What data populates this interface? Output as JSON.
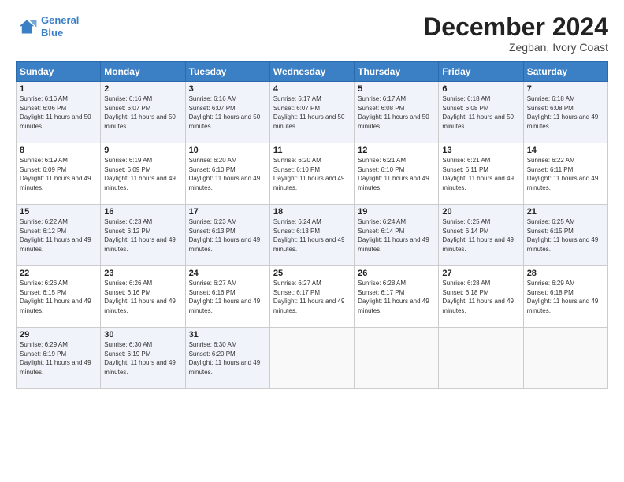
{
  "header": {
    "logo_line1": "General",
    "logo_line2": "Blue",
    "month_title": "December 2024",
    "location": "Zegban, Ivory Coast"
  },
  "weekdays": [
    "Sunday",
    "Monday",
    "Tuesday",
    "Wednesday",
    "Thursday",
    "Friday",
    "Saturday"
  ],
  "weeks": [
    [
      {
        "day": "1",
        "rise": "6:16 AM",
        "set": "6:06 PM",
        "daylight": "11 hours and 50 minutes."
      },
      {
        "day": "2",
        "rise": "6:16 AM",
        "set": "6:07 PM",
        "daylight": "11 hours and 50 minutes."
      },
      {
        "day": "3",
        "rise": "6:16 AM",
        "set": "6:07 PM",
        "daylight": "11 hours and 50 minutes."
      },
      {
        "day": "4",
        "rise": "6:17 AM",
        "set": "6:07 PM",
        "daylight": "11 hours and 50 minutes."
      },
      {
        "day": "5",
        "rise": "6:17 AM",
        "set": "6:08 PM",
        "daylight": "11 hours and 50 minutes."
      },
      {
        "day": "6",
        "rise": "6:18 AM",
        "set": "6:08 PM",
        "daylight": "11 hours and 50 minutes."
      },
      {
        "day": "7",
        "rise": "6:18 AM",
        "set": "6:08 PM",
        "daylight": "11 hours and 49 minutes."
      }
    ],
    [
      {
        "day": "8",
        "rise": "6:19 AM",
        "set": "6:09 PM",
        "daylight": "11 hours and 49 minutes."
      },
      {
        "day": "9",
        "rise": "6:19 AM",
        "set": "6:09 PM",
        "daylight": "11 hours and 49 minutes."
      },
      {
        "day": "10",
        "rise": "6:20 AM",
        "set": "6:10 PM",
        "daylight": "11 hours and 49 minutes."
      },
      {
        "day": "11",
        "rise": "6:20 AM",
        "set": "6:10 PM",
        "daylight": "11 hours and 49 minutes."
      },
      {
        "day": "12",
        "rise": "6:21 AM",
        "set": "6:10 PM",
        "daylight": "11 hours and 49 minutes."
      },
      {
        "day": "13",
        "rise": "6:21 AM",
        "set": "6:11 PM",
        "daylight": "11 hours and 49 minutes."
      },
      {
        "day": "14",
        "rise": "6:22 AM",
        "set": "6:11 PM",
        "daylight": "11 hours and 49 minutes."
      }
    ],
    [
      {
        "day": "15",
        "rise": "6:22 AM",
        "set": "6:12 PM",
        "daylight": "11 hours and 49 minutes."
      },
      {
        "day": "16",
        "rise": "6:23 AM",
        "set": "6:12 PM",
        "daylight": "11 hours and 49 minutes."
      },
      {
        "day": "17",
        "rise": "6:23 AM",
        "set": "6:13 PM",
        "daylight": "11 hours and 49 minutes."
      },
      {
        "day": "18",
        "rise": "6:24 AM",
        "set": "6:13 PM",
        "daylight": "11 hours and 49 minutes."
      },
      {
        "day": "19",
        "rise": "6:24 AM",
        "set": "6:14 PM",
        "daylight": "11 hours and 49 minutes."
      },
      {
        "day": "20",
        "rise": "6:25 AM",
        "set": "6:14 PM",
        "daylight": "11 hours and 49 minutes."
      },
      {
        "day": "21",
        "rise": "6:25 AM",
        "set": "6:15 PM",
        "daylight": "11 hours and 49 minutes."
      }
    ],
    [
      {
        "day": "22",
        "rise": "6:26 AM",
        "set": "6:15 PM",
        "daylight": "11 hours and 49 minutes."
      },
      {
        "day": "23",
        "rise": "6:26 AM",
        "set": "6:16 PM",
        "daylight": "11 hours and 49 minutes."
      },
      {
        "day": "24",
        "rise": "6:27 AM",
        "set": "6:16 PM",
        "daylight": "11 hours and 49 minutes."
      },
      {
        "day": "25",
        "rise": "6:27 AM",
        "set": "6:17 PM",
        "daylight": "11 hours and 49 minutes."
      },
      {
        "day": "26",
        "rise": "6:28 AM",
        "set": "6:17 PM",
        "daylight": "11 hours and 49 minutes."
      },
      {
        "day": "27",
        "rise": "6:28 AM",
        "set": "6:18 PM",
        "daylight": "11 hours and 49 minutes."
      },
      {
        "day": "28",
        "rise": "6:29 AM",
        "set": "6:18 PM",
        "daylight": "11 hours and 49 minutes."
      }
    ],
    [
      {
        "day": "29",
        "rise": "6:29 AM",
        "set": "6:19 PM",
        "daylight": "11 hours and 49 minutes."
      },
      {
        "day": "30",
        "rise": "6:30 AM",
        "set": "6:19 PM",
        "daylight": "11 hours and 49 minutes."
      },
      {
        "day": "31",
        "rise": "6:30 AM",
        "set": "6:20 PM",
        "daylight": "11 hours and 49 minutes."
      },
      null,
      null,
      null,
      null
    ]
  ]
}
